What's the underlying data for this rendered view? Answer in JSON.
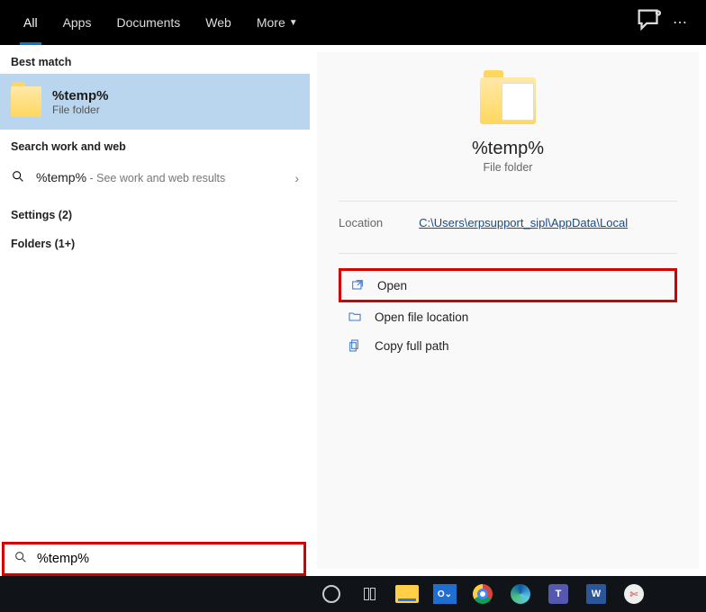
{
  "tabs": {
    "all": "All",
    "apps": "Apps",
    "documents": "Documents",
    "web": "Web",
    "more": "More"
  },
  "left": {
    "best_header": "Best match",
    "best": {
      "title": "%temp%",
      "sub": "File folder"
    },
    "web_header": "Search work and web",
    "web": {
      "query": "%temp%",
      "hint": " - See work and web results"
    },
    "settings_header": "Settings (2)",
    "folders_header": "Folders (1+)"
  },
  "preview": {
    "title": "%temp%",
    "sub": "File folder",
    "loc_key": "Location",
    "loc_val": "C:\\Users\\erpsupport_sipl\\AppData\\Local",
    "actions": {
      "open": "Open",
      "openloc": "Open file location",
      "copypath": "Copy full path"
    }
  },
  "search": {
    "value": "%temp%"
  },
  "taskbar": {
    "outlook": "O⌄",
    "teams": "T",
    "word": "W"
  }
}
